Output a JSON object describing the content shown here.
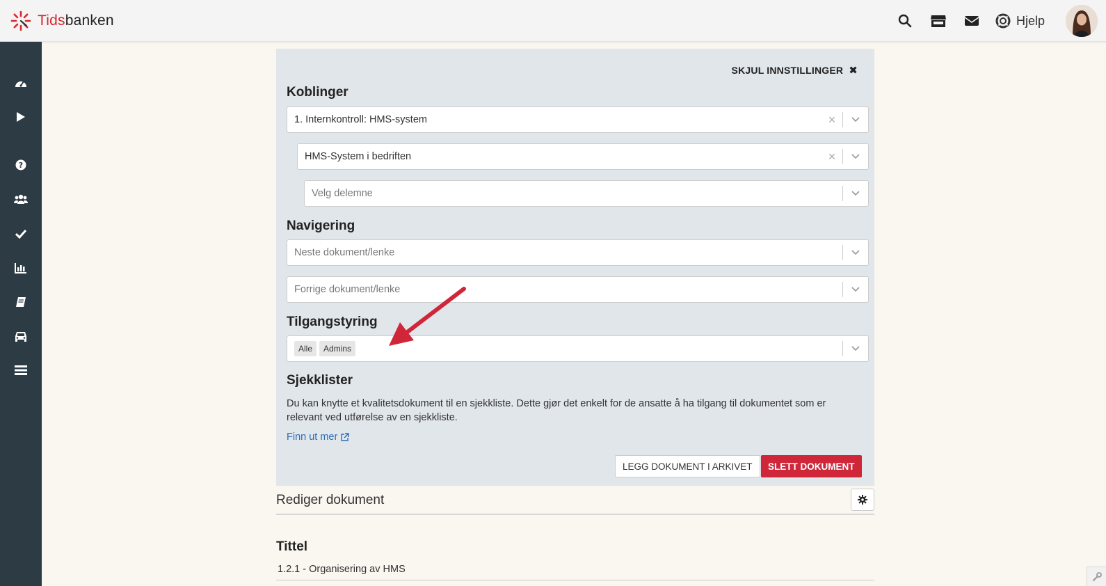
{
  "header": {
    "logo_part1": "Tids",
    "logo_part2": "banken",
    "help_label": "Hjelp"
  },
  "sidebar": {
    "items": [
      "dashboard-icon",
      "play-icon",
      "help-icon",
      "users-icon",
      "check-icon",
      "chart-icon",
      "book-icon",
      "car-icon",
      "list-icon"
    ]
  },
  "settings": {
    "hide_label": "SKJUL INNSTILLINGER",
    "koblinger": {
      "title": "Koblinger",
      "select1_value": "1. Internkontroll: HMS-system",
      "select2_value": "HMS-System i bedriften",
      "select3_placeholder": "Velg delemne"
    },
    "navigering": {
      "title": "Navigering",
      "next_placeholder": "Neste dokument/lenke",
      "prev_placeholder": "Forrige dokument/lenke"
    },
    "tilgangstyring": {
      "title": "Tilgangstyring",
      "tags": [
        "Alle",
        "Admins"
      ]
    },
    "sjekklister": {
      "title": "Sjekklister",
      "description": "Du kan knytte et kvalitetsdokument til en sjekkliste. Dette gjør det enkelt for de ansatte å ha tilgang til dokumentet som er relevant ved utførelse av en sjekkliste.",
      "link_label": "Finn ut mer"
    },
    "archive_button": "LEGG DOKUMENT I ARKIVET",
    "delete_button": "SLETT DOKUMENT"
  },
  "editor": {
    "title": "Rediger dokument",
    "field_label": "Tittel",
    "field_value": "1.2.1 - Organisering av HMS"
  },
  "colors": {
    "accent_red": "#d0263a",
    "sidebar_bg": "#2d3b45",
    "settings_bg": "#e1e6eb",
    "link_blue": "#2a6db5"
  }
}
